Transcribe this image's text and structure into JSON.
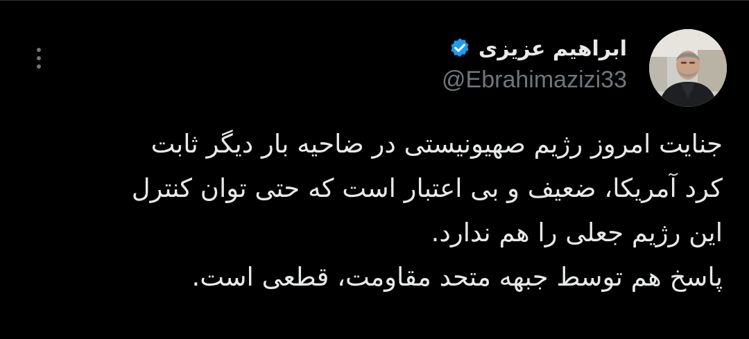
{
  "author": {
    "display_name": "ابراهیم عزیزی",
    "handle": "@Ebrahimazizi33",
    "verified": true,
    "verified_icon": "verified-badge-icon",
    "avatar_icon": "profile-photo"
  },
  "menu": {
    "icon": "more-options-icon"
  },
  "tweet": {
    "lines": [
      "جنایت امروز رژیم صهیونیستی در ضاحیه بار دیگر ثابت",
      "کرد آمریکا، ضعیف و بی اعتبار است که حتی توان کنترل",
      "این رژیم جعلی را هم ندارد.",
      "پاسخ هم توسط جبهه متحد مقاومت، قطعی است."
    ]
  },
  "colors": {
    "background": "#000000",
    "text_primary": "#e7e9ea",
    "text_secondary": "#71767b",
    "verified_blue": "#1d9bf0"
  }
}
